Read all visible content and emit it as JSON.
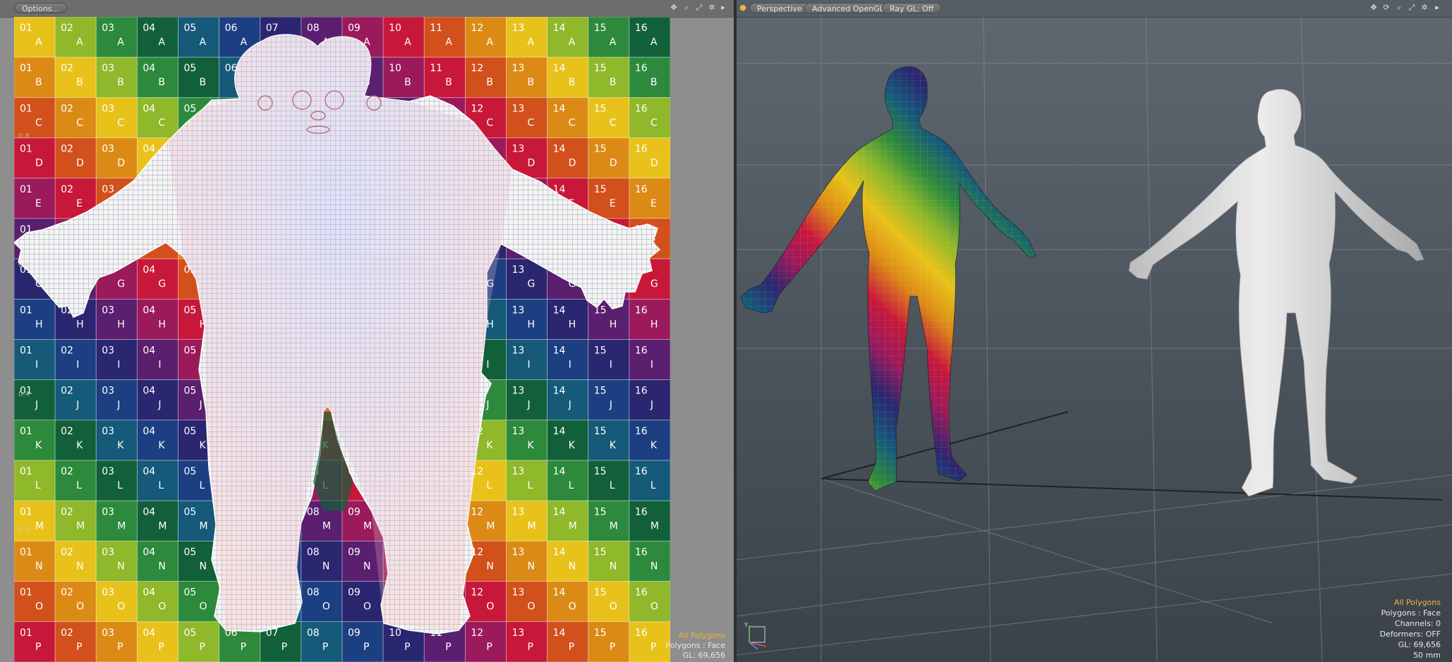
{
  "uv_editor": {
    "options_button": "Options...",
    "readout": {
      "line1": "All Polygons",
      "line2": "Polygons : Face",
      "line3": "GL: 69,656"
    },
    "uv_ticks": [
      "0.8",
      "0.6",
      "0.4",
      "0.2"
    ],
    "grid": {
      "columns": [
        "01",
        "02",
        "03",
        "04",
        "05",
        "06",
        "07",
        "08",
        "09",
        "10",
        "11",
        "12",
        "13",
        "14",
        "15",
        "16"
      ],
      "rows": [
        "A",
        "B",
        "C",
        "D",
        "E",
        "F",
        "G",
        "H",
        "I",
        "J",
        "K",
        "L",
        "M",
        "N",
        "O",
        "P"
      ]
    },
    "icons": [
      "move-icon",
      "zoom-icon",
      "fit-icon",
      "settings-icon",
      "expand-arrow-icon"
    ]
  },
  "viewport": {
    "view_button": "Perspective",
    "shading_button": "Advanced OpenGL",
    "raygl_button": "Ray GL: Off",
    "readout": {
      "line1": "All Polygons",
      "line2": "Polygons : Face",
      "line3": "Channels: 0",
      "line4": "Deformers: OFF",
      "line5": "GL: 69,656",
      "line6": "50 mm"
    },
    "axis_label": "Y",
    "icons": [
      "move-icon",
      "rotate-icon",
      "zoom-icon",
      "fit-icon",
      "settings-icon",
      "expand-arrow-icon"
    ]
  },
  "colors": {
    "accent": "#f0b43a",
    "checker_palette": [
      "#e8c21a",
      "#8fb82a",
      "#2d8a3c",
      "#12603a",
      "#155a78",
      "#1c3f82",
      "#2a2670",
      "#5a1f6e",
      "#9a1a5c",
      "#c8183a",
      "#d2501c",
      "#dc8a16"
    ]
  }
}
